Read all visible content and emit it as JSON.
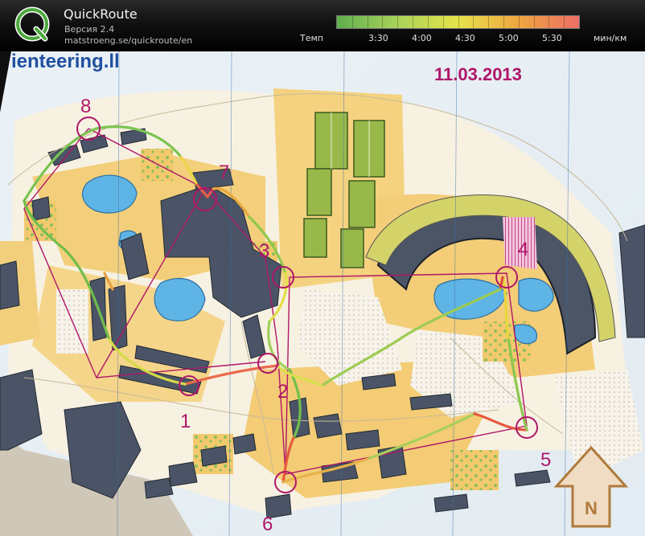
{
  "app": {
    "name": "QuickRoute",
    "version": "Версия 2.4",
    "url": "matstroeng.se/quickroute/en"
  },
  "legend": {
    "title": "Темп",
    "ticks": [
      "3:30",
      "4:00",
      "4:30",
      "5:00",
      "5:30"
    ],
    "unit": "мин/км",
    "colors": [
      "#5fae4e",
      "#a9d35a",
      "#e6e34a",
      "#f0a640",
      "#ee6f65"
    ]
  },
  "map": {
    "header_text": "ienteering.ll",
    "date": "11.03.2013",
    "controls": [
      "1",
      "2",
      "3",
      "4",
      "5",
      "6",
      "7",
      "8"
    ],
    "north_label": "N",
    "colors": {
      "paper": "#eef2f7",
      "open_land": "#f3c96e",
      "forest": "#f8f4e6",
      "water": "#5fb4e6",
      "building": "#4a5466",
      "course": "#b0166a"
    }
  }
}
